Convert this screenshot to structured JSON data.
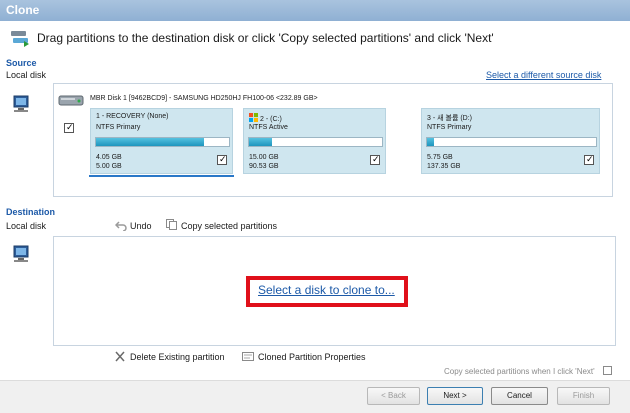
{
  "window": {
    "title": "Clone"
  },
  "header": {
    "instruction": "Drag partitions to the destination disk or click 'Copy selected partitions' and click 'Next'"
  },
  "source": {
    "label": "Source",
    "sublabel": "Local disk",
    "change_link": "Select a different source disk",
    "disk_title": "MBR Disk 1 [9462BCD9] - SAMSUNG HD250HJ FH100-06  <232.89 GB>",
    "partitions": [
      {
        "name": "1 - RECOVERY (None)",
        "type": "NTFS Primary",
        "used": "4.05 GB",
        "total": "5.00 GB",
        "fill_fraction": 0.81,
        "checked": true
      },
      {
        "name": "2 -  (C:)",
        "type": "NTFS Active",
        "used": "15.00 GB",
        "total": "90.53 GB",
        "fill_fraction": 0.17,
        "checked": true
      },
      {
        "name": "3 - 새 볼륨 (D:)",
        "type": "NTFS Primary",
        "used": "5.75 GB",
        "total": "137.35 GB",
        "fill_fraction": 0.04,
        "checked": true
      }
    ]
  },
  "destination": {
    "label": "Destination",
    "sublabel": "Local disk",
    "undo_label": "Undo",
    "copy_label": "Copy selected partitions",
    "select_disk_link": "Select a disk to clone to...",
    "delete_label": "Delete Existing partition",
    "properties_label": "Cloned Partition Properties"
  },
  "options": {
    "copy_on_next_label": "Copy selected partitions when I click 'Next'"
  },
  "footer": {
    "back_label": "< Back",
    "next_label": "Next >",
    "cancel_label": "Cancel",
    "finish_label": "Finish"
  },
  "colors": {
    "accent": "#1d5aa8",
    "highlight": "#e0101a",
    "partition_bg": "#cfe6ef",
    "fill": "#1e95bd"
  }
}
